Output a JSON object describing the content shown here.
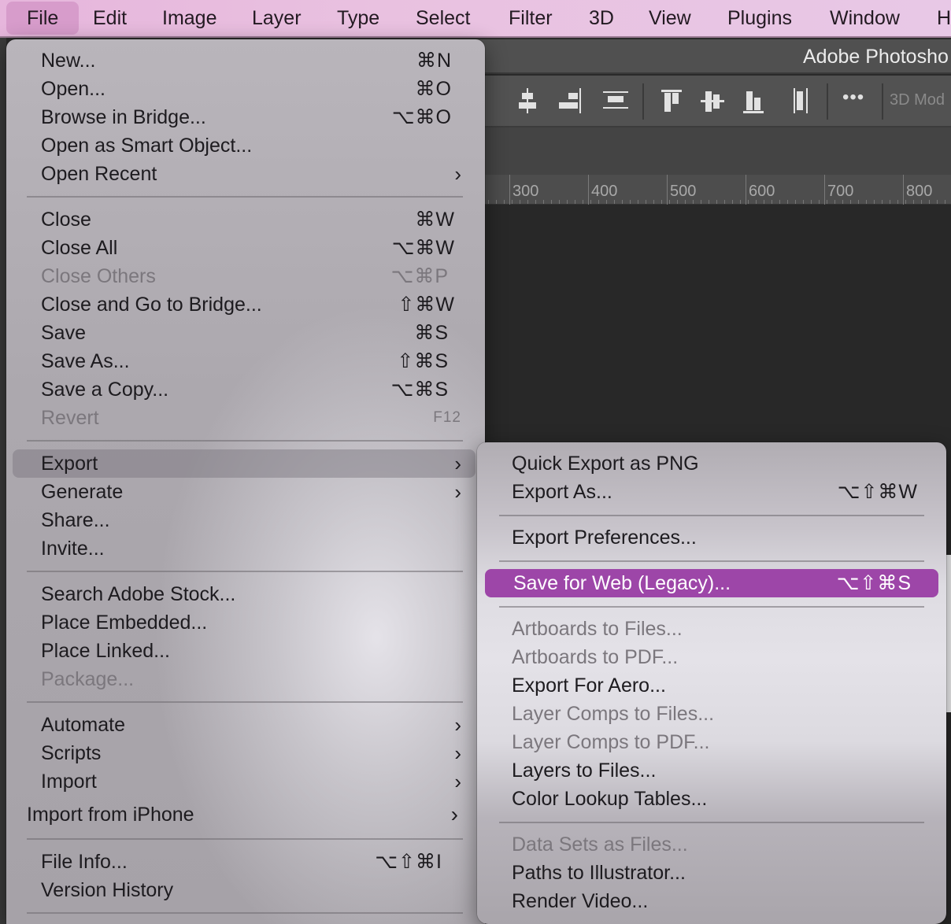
{
  "menubar": {
    "items": [
      "File",
      "Edit",
      "Image",
      "Layer",
      "Type",
      "Select",
      "Filter",
      "3D",
      "View",
      "Plugins",
      "Window",
      "H"
    ],
    "active": "File"
  },
  "app": {
    "title": "Adobe Photosho",
    "options_bar": {
      "icons": [
        "align-bottom-edges-icon",
        "align-horizontal-centers-icon",
        "align-right-edges-icon",
        "distribute-horizontal-icon",
        "align-top-icon",
        "align-vertical-centers-icon",
        "align-bottom-icon",
        "distribute-vertical-icon"
      ],
      "more_label": "•••",
      "mode_label": "3D Mod"
    },
    "ruler": [
      "300",
      "400",
      "500",
      "600",
      "700",
      "800"
    ]
  },
  "file_menu": {
    "groups": [
      [
        {
          "label": "New...",
          "shortcut": "⌘N"
        },
        {
          "label": "Open...",
          "shortcut": "⌘O"
        },
        {
          "label": "Browse in Bridge...",
          "shortcut": "⌥⌘O"
        },
        {
          "label": "Open as Smart Object..."
        },
        {
          "label": "Open Recent",
          "submenu": true
        }
      ],
      [
        {
          "label": "Close",
          "shortcut": "⌘W"
        },
        {
          "label": "Close All",
          "shortcut": "⌥⌘W"
        },
        {
          "label": "Close Others",
          "shortcut": "⌥⌘P",
          "disabled": true
        },
        {
          "label": "Close and Go to Bridge...",
          "shortcut": "⇧⌘W"
        },
        {
          "label": "Save",
          "shortcut": "⌘S"
        },
        {
          "label": "Save As...",
          "shortcut": "⇧⌘S"
        },
        {
          "label": "Save a Copy...",
          "shortcut": "⌥⌘S"
        },
        {
          "label": "Revert",
          "shortcut": "F12",
          "disabled": true
        }
      ],
      [
        {
          "label": "Export",
          "submenu": true,
          "highlighted": true
        },
        {
          "label": "Generate",
          "submenu": true
        },
        {
          "label": "Share..."
        },
        {
          "label": "Invite..."
        }
      ],
      [
        {
          "label": "Search Adobe Stock..."
        },
        {
          "label": "Place Embedded..."
        },
        {
          "label": "Place Linked..."
        },
        {
          "label": "Package...",
          "disabled": true
        }
      ],
      [
        {
          "label": "Automate",
          "submenu": true
        },
        {
          "label": "Scripts",
          "submenu": true
        },
        {
          "label": "Import",
          "submenu": true
        },
        {
          "label": "Import from iPhone",
          "submenu": true
        }
      ],
      [
        {
          "label": "File Info...",
          "shortcut": "⌥⇧⌘I"
        },
        {
          "label": "Version History"
        }
      ]
    ],
    "submenu_arrow": "›"
  },
  "export_menu": {
    "groups": [
      [
        {
          "label": "Quick Export as PNG"
        },
        {
          "label": "Export As...",
          "shortcut": "⌥⇧⌘W"
        }
      ],
      [
        {
          "label": "Export Preferences..."
        }
      ],
      [
        {
          "label": "Save for Web (Legacy)...",
          "shortcut": "⌥⇧⌘S",
          "selected": true
        }
      ],
      [
        {
          "label": "Artboards to Files...",
          "disabled": true
        },
        {
          "label": "Artboards to PDF...",
          "disabled": true
        },
        {
          "label": "Export For Aero..."
        },
        {
          "label": "Layer Comps to Files...",
          "disabled": true
        },
        {
          "label": "Layer Comps to PDF...",
          "disabled": true
        },
        {
          "label": "Layers to Files..."
        },
        {
          "label": "Color Lookup Tables..."
        }
      ],
      [
        {
          "label": "Data Sets as Files...",
          "disabled": true
        },
        {
          "label": "Paths to Illustrator..."
        },
        {
          "label": "Render Video..."
        }
      ]
    ]
  },
  "colors": {
    "menubar_tint": "#e8c0e0",
    "selection_purple": "#9d46a8",
    "hover_grey": "#8f8b92",
    "disabled_text": "#7b777d"
  }
}
